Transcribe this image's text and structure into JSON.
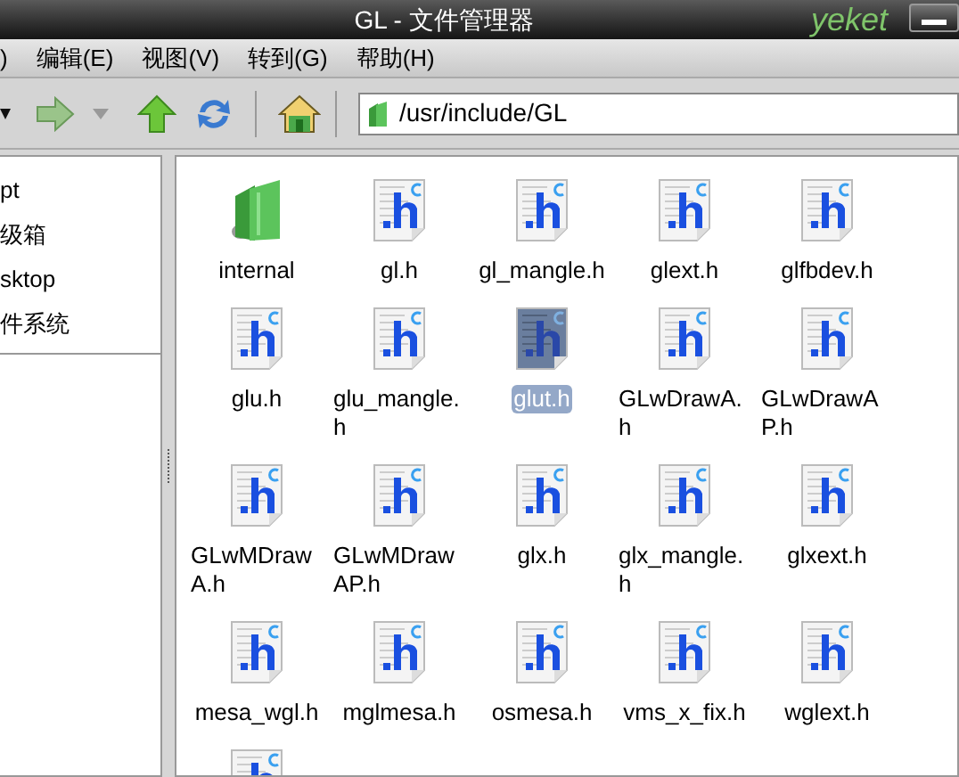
{
  "window": {
    "title": "GL - 文件管理器",
    "logo": "yeket"
  },
  "menu": [
    {
      "label": ")"
    },
    {
      "label": "编辑(E)"
    },
    {
      "label": "视图(V)"
    },
    {
      "label": "转到(G)"
    },
    {
      "label": "帮助(H)"
    }
  ],
  "toolbar": {
    "location": "/usr/include/GL"
  },
  "sidebar": {
    "items": [
      {
        "label": "pt"
      },
      {
        "label": "级箱"
      },
      {
        "label": "sktop"
      },
      {
        "label": "件系统"
      }
    ]
  },
  "files": [
    {
      "kind": "folder",
      "name": "internal",
      "selected": false
    },
    {
      "kind": "header",
      "name": "gl.h",
      "selected": false
    },
    {
      "kind": "header",
      "name": "gl_mangle.h",
      "selected": false
    },
    {
      "kind": "header",
      "name": "glext.h",
      "selected": false
    },
    {
      "kind": "header",
      "name": "glfbdev.h",
      "selected": false
    },
    {
      "kind": "header",
      "name": "glu.h",
      "selected": false
    },
    {
      "kind": "header",
      "name": "glu_mangle.h",
      "selected": false
    },
    {
      "kind": "header",
      "name": "glut.h",
      "selected": true
    },
    {
      "kind": "header",
      "name": "GLwDrawA.h",
      "selected": false
    },
    {
      "kind": "header",
      "name": "GLwDrawAP.h",
      "selected": false
    },
    {
      "kind": "header",
      "name": "GLwMDrawA.h",
      "selected": false
    },
    {
      "kind": "header",
      "name": "GLwMDrawAP.h",
      "selected": false
    },
    {
      "kind": "header",
      "name": "glx.h",
      "selected": false
    },
    {
      "kind": "header",
      "name": "glx_mangle.h",
      "selected": false
    },
    {
      "kind": "header",
      "name": "glxext.h",
      "selected": false
    },
    {
      "kind": "header",
      "name": "mesa_wgl.h",
      "selected": false
    },
    {
      "kind": "header",
      "name": "mglmesa.h",
      "selected": false
    },
    {
      "kind": "header",
      "name": "osmesa.h",
      "selected": false
    },
    {
      "kind": "header",
      "name": "vms_x_fix.h",
      "selected": false
    },
    {
      "kind": "header",
      "name": "wglext.h",
      "selected": false
    },
    {
      "kind": "header",
      "selected": false
    }
  ]
}
